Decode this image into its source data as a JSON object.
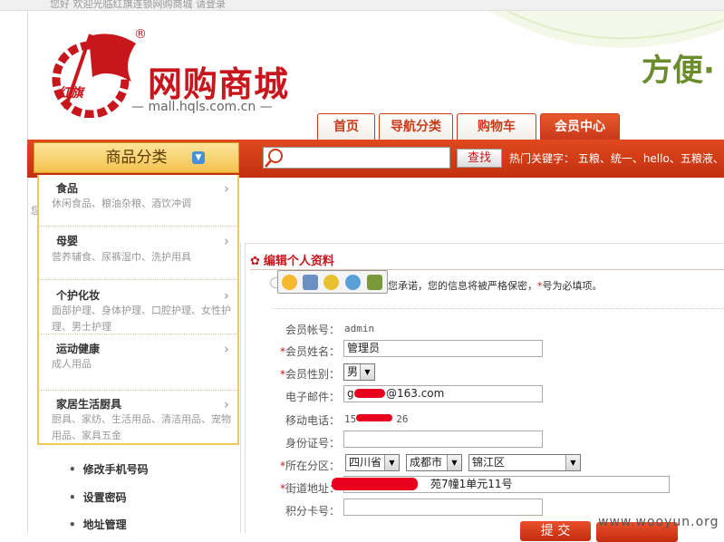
{
  "topbar": {
    "text": "您好  欢迎光临红旗连锁网购商城  请登录"
  },
  "brand": {
    "logo_char": "红旗",
    "title": "网购商城",
    "url": "mall.hqls.com.cn",
    "reg": "®",
    "slogan": "方便·"
  },
  "tabs": [
    {
      "label": "首页"
    },
    {
      "label": "导航分类"
    },
    {
      "label": "购物车"
    },
    {
      "label": "会员中心"
    }
  ],
  "nav": {
    "category_label": "商品分类",
    "search_placeholder": "",
    "search_button": "查找",
    "hot_keywords": "热门关键字： 五粮、统一、hello、五粮液、"
  },
  "categories": [
    {
      "name": "食品",
      "sub": "休闲食品、粮油杂粮、酒饮冲调"
    },
    {
      "name": "母婴",
      "sub": "营养辅食、尿裤湿巾、洗护用具"
    },
    {
      "name": "个护化妆",
      "sub": "面部护理、身体护理、口腔护理、女性护理、男士护理"
    },
    {
      "name": "运动健康",
      "sub": "成人用品"
    },
    {
      "name": "家居生活厨具",
      "sub": "厨具、家纺、生活用品、清洁用品、宠物用品、家具五金"
    }
  ],
  "left_links": [
    {
      "label": "修改手机号码"
    },
    {
      "label": "设置密码"
    },
    {
      "label": "地址管理"
    }
  ],
  "left_fragment": "您",
  "section": {
    "title": "编辑个人资料",
    "notice_prefix": "您承诺，您的信息将被严格保密，",
    "notice_star": "*",
    "notice_suffix": "号为必填项。"
  },
  "form": {
    "account_label": "会员帐号：",
    "account_value": "admin",
    "name_label": "会员姓名：",
    "name_value": "管理员",
    "gender_label": "会员性别：",
    "gender_value": "男",
    "email_label": "电子邮件：",
    "email_value_prefix": "ga",
    "email_value_suffix": "@163.com",
    "phone_label": "移动电话：",
    "phone_value_prefix": "15",
    "phone_value_suffix": "26",
    "id_label": "身份证号：",
    "region_label": "所在分区：",
    "province": "四川省",
    "city": "成都市",
    "district": "锦江区",
    "street_label": "街道地址：",
    "street_value": "苑7幢1单元11号",
    "card_label": "积分卡号：",
    "required_star": "*"
  },
  "submit_label": "提 交",
  "watermark": "www.wooyun.org",
  "colors": {
    "brand_red": "#c8161d",
    "nav_red": "#d2391a",
    "category_gold": "#f3c24d",
    "slogan_green": "#6a8c2a"
  }
}
